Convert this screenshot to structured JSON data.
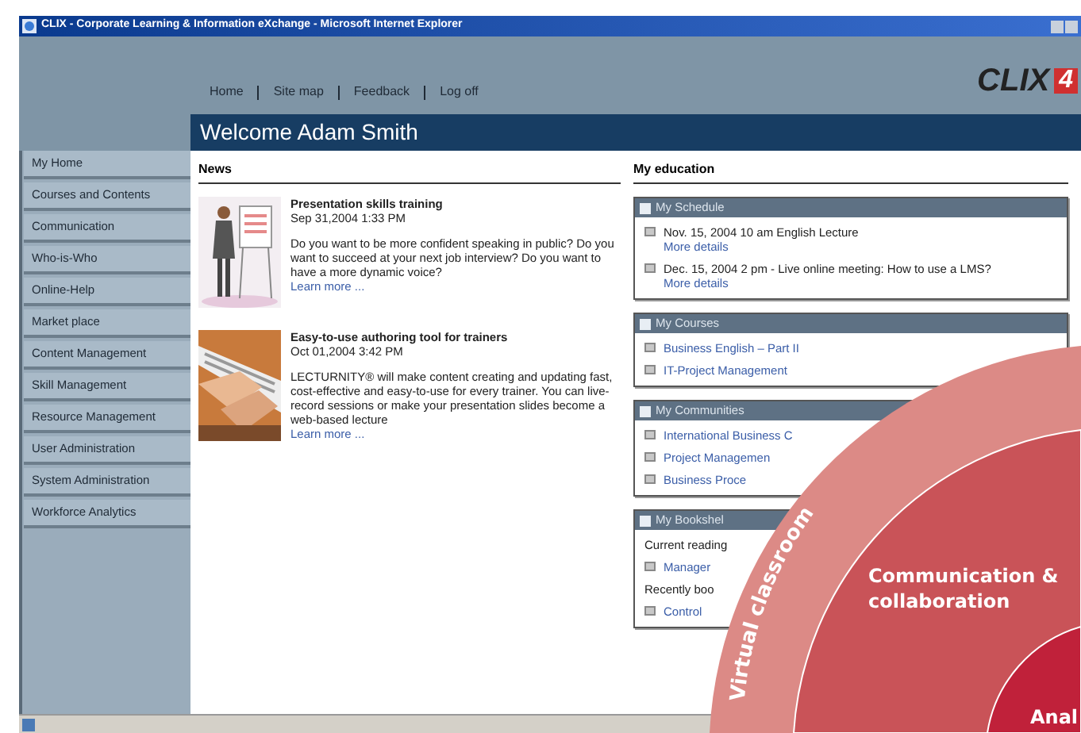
{
  "window": {
    "title": "CLIX - Corporate Learning & Information eXchange - Microsoft Internet Explorer"
  },
  "top_nav": [
    "Home",
    "Site map",
    "Feedback",
    "Log off"
  ],
  "logo": {
    "text": "CLIX",
    "badge": "4"
  },
  "welcome": "Welcome Adam Smith",
  "sidebar": {
    "items": [
      "My Home",
      "Courses and Contents",
      "Communication",
      "Who-is-Who",
      "Online-Help",
      "Market place",
      "Content Management",
      "Skill Management",
      "Resource Management",
      "User Administration",
      "System Administration",
      "Workforce Analytics"
    ]
  },
  "news": {
    "heading": "News",
    "items": [
      {
        "kind": "presenter",
        "title": "Presentation skills training",
        "date": "Sep 31,2004 1:33 PM",
        "body": "Do you want to be more confident speaking in public? Do you want to succeed at your next job interview? Do you want to have a more dynamic voice?",
        "link": "Learn more ..."
      },
      {
        "kind": "keyboard",
        "title": "Easy-to-use authoring tool for trainers",
        "date": "Oct 01,2004 3:42 PM",
        "body": "LECTURNITY® will make content creating and updating fast, cost-effective and easy-to-use for every trainer. You can live-record sessions or make your presentation slides become a web-based lecture",
        "link": "Learn more ..."
      }
    ]
  },
  "my_education": {
    "heading": "My education",
    "boxes": [
      {
        "title": "My Schedule",
        "entries": [
          {
            "kind": "event",
            "text": "Nov. 15, 2004 10 am English Lecture",
            "link": "More details"
          },
          {
            "kind": "event",
            "text": "Dec. 15, 2004 2 pm  - Live online meeting: How to use a LMS?",
            "link": "More details"
          }
        ]
      },
      {
        "title": "My Courses",
        "entries": [
          {
            "kind": "link",
            "text": "Business English – Part II"
          },
          {
            "kind": "link",
            "text": "IT-Project Management"
          }
        ]
      },
      {
        "title": "My Communities",
        "entries": [
          {
            "kind": "link",
            "text": "International Business C"
          },
          {
            "kind": "link",
            "text": "Project Managemen"
          },
          {
            "kind": "link",
            "text": "Business Proce"
          }
        ]
      },
      {
        "title": "My Bookshel",
        "entries": [
          {
            "kind": "label",
            "text": "Current reading"
          },
          {
            "kind": "link",
            "text": "Manager"
          },
          {
            "kind": "label",
            "text": "Recently boo"
          },
          {
            "kind": "link",
            "text": "Control"
          }
        ]
      }
    ]
  },
  "overlay": {
    "rings": [
      "Virtual classroom",
      "Communication & collaboration",
      "Anal"
    ]
  }
}
